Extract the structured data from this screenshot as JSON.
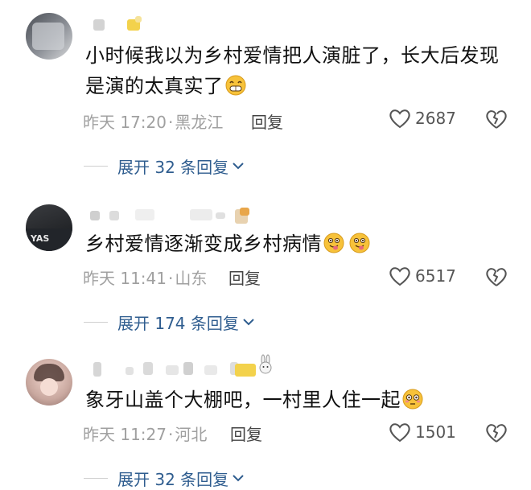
{
  "comments": [
    {
      "text": "小时候我以为乡村爱情把人演脏了，长大后发现是演的太真实了",
      "time": "昨天 17:20",
      "location": "黑龙江",
      "reply_label": "回复",
      "likes": "2687",
      "expand_label": "展开 32 条回复",
      "emojis": [
        "grin-emoji"
      ]
    },
    {
      "text": "乡村爱情逐渐变成乡村病情",
      "time": "昨天 11:41",
      "location": "山东",
      "reply_label": "回复",
      "likes": "6517",
      "expand_label": "展开 174 条回复",
      "emojis": [
        "tongue-emoji",
        "tongue-emoji"
      ]
    },
    {
      "text": "象牙山盖个大棚吧，一村里人住一起",
      "time": "昨天 11:27",
      "location": "河北",
      "reply_label": "回复",
      "likes": "1501",
      "expand_label": "展开 32 条回复",
      "emojis": [
        "flushed-emoji"
      ]
    }
  ],
  "avatar_badge_text": "YAS",
  "colors": {
    "link": "#2f5d8f",
    "meta": "#a0a0a0",
    "text": "#111111",
    "emoji": "#f7c23a"
  }
}
